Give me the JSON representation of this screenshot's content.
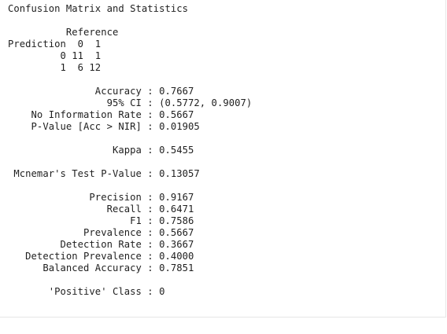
{
  "console": {
    "lines": [
      "Confusion Matrix and Statistics",
      "",
      "          Reference",
      "Prediction  0  1",
      "         0 11  1",
      "         1  6 12",
      "",
      "               Accuracy : 0.7667",
      "                 95% CI : (0.5772, 0.9007)",
      "    No Information Rate : 0.5667",
      "    P-Value [Acc > NIR] : 0.01905",
      "",
      "                  Kappa : 0.5455",
      "",
      " Mcnemar's Test P-Value : 0.13057",
      "",
      "              Precision : 0.9167",
      "                 Recall : 0.6471",
      "                     F1 : 0.7586",
      "             Prevalence : 0.5667",
      "         Detection Rate : 0.3667",
      "   Detection Prevalence : 0.4000",
      "      Balanced Accuracy : 0.7851",
      "",
      "       'Positive' Class : 0"
    ]
  }
}
